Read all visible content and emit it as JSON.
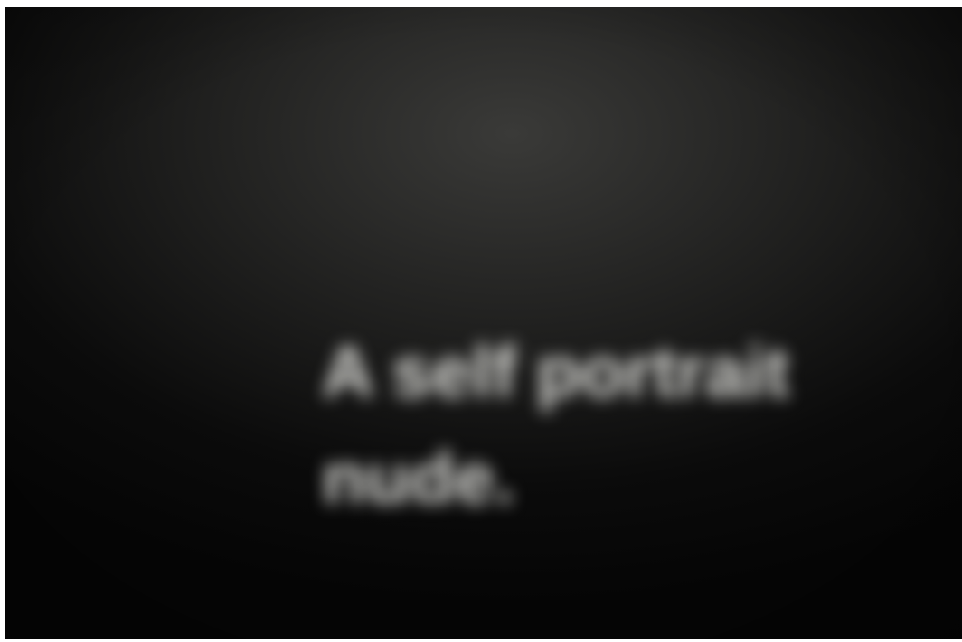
{
  "screen": {
    "description_visible": false,
    "background_color": "#0b0b0b",
    "text_color": "#d8d8d4"
  },
  "header": {
    "title": ""
  },
  "meta": {
    "items": [
      "",
      "",
      ""
    ]
  },
  "hero": {
    "title_line1": "A self portrait",
    "title_line2": "nude."
  },
  "footer": {
    "items": [
      "",
      "",
      ""
    ]
  },
  "side": {
    "text": "",
    "small": ""
  }
}
